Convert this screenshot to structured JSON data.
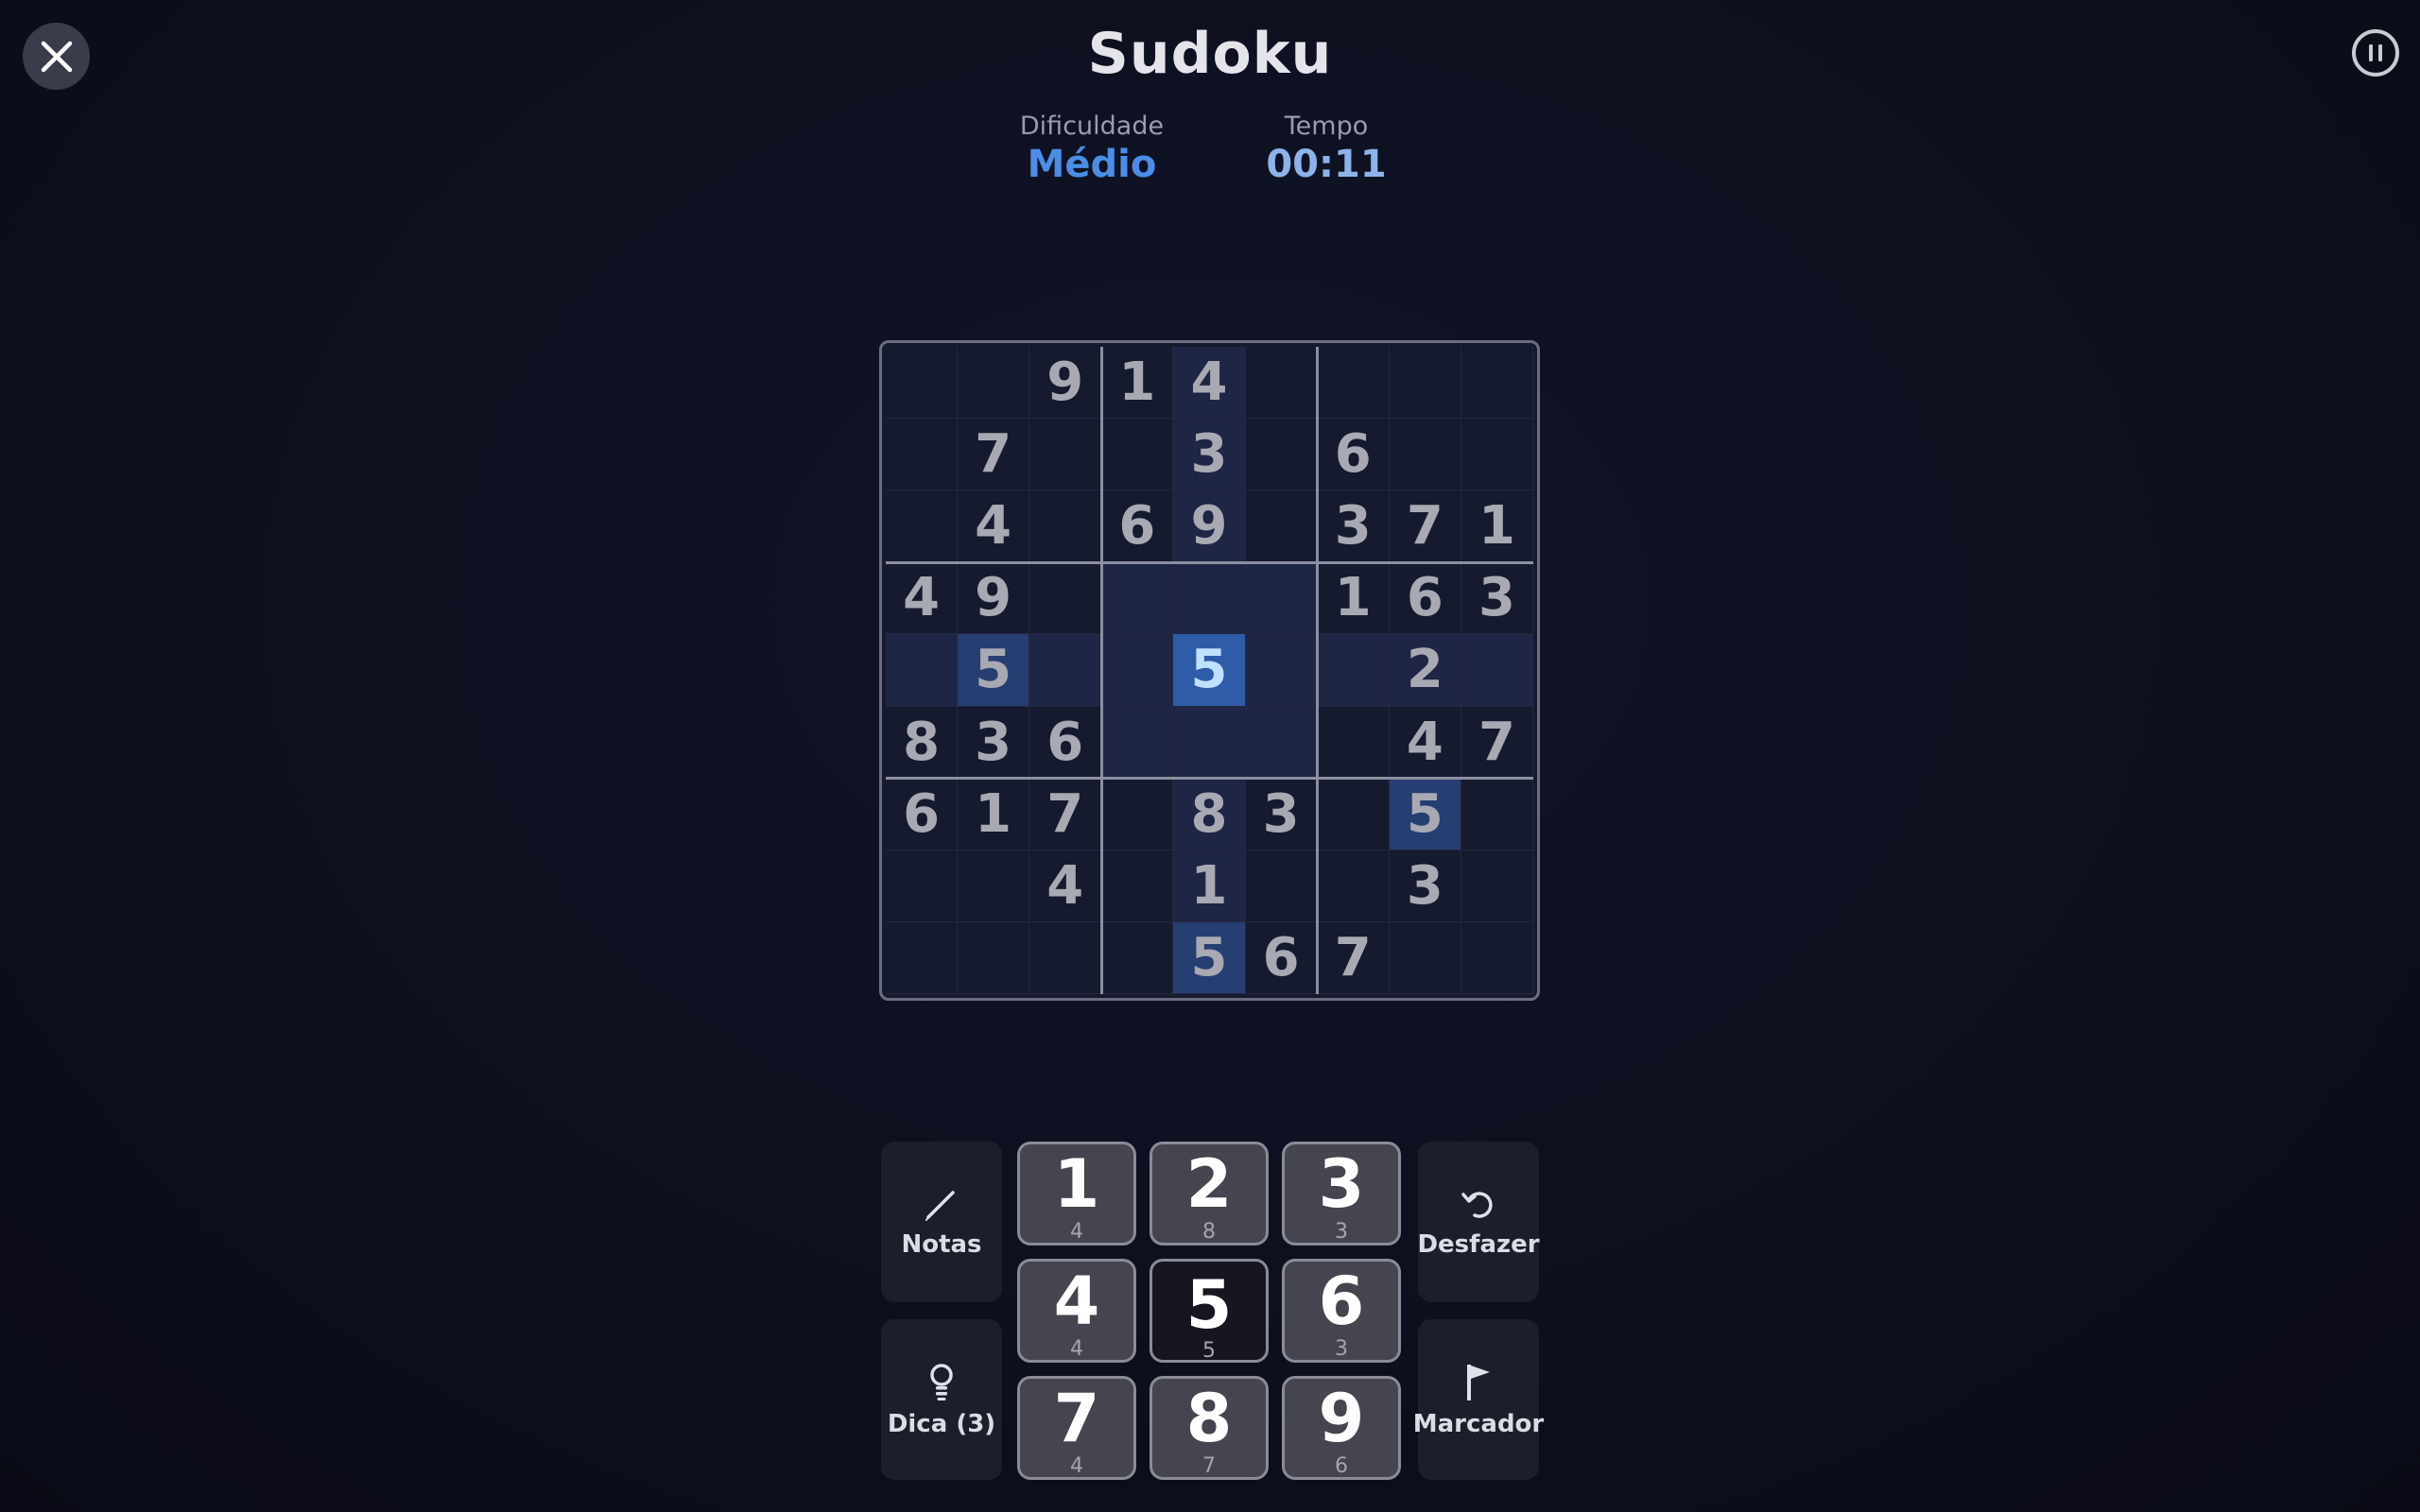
{
  "header": {
    "title": "Sudoku",
    "difficulty_label": "Dificuldade",
    "difficulty_value": "Médio",
    "time_label": "Tempo",
    "time_value": "00:11"
  },
  "board": {
    "rows": [
      [
        "",
        "",
        "9",
        "1",
        "4",
        "",
        "",
        "",
        ""
      ],
      [
        "",
        "7",
        "",
        "",
        "3",
        "",
        "6",
        "",
        ""
      ],
      [
        "",
        "4",
        "",
        "6",
        "9",
        "",
        "3",
        "7",
        "1"
      ],
      [
        "4",
        "9",
        "",
        "",
        "",
        "",
        "1",
        "6",
        "3"
      ],
      [
        "",
        "5",
        "",
        "",
        "5",
        "",
        "",
        "2",
        ""
      ],
      [
        "8",
        "3",
        "6",
        "",
        "",
        "",
        "",
        "4",
        "7"
      ],
      [
        "6",
        "1",
        "7",
        "",
        "8",
        "3",
        "",
        "5",
        ""
      ],
      [
        "",
        "",
        "4",
        "",
        "1",
        "",
        "",
        "3",
        ""
      ],
      [
        "",
        "",
        "",
        "",
        "5",
        "6",
        "7",
        "",
        ""
      ]
    ],
    "selected": [
      4,
      4
    ],
    "same_value_cells": [
      [
        4,
        1
      ],
      [
        6,
        7
      ],
      [
        8,
        4
      ]
    ]
  },
  "keypad": [
    {
      "digit": "1",
      "count": "4"
    },
    {
      "digit": "2",
      "count": "8"
    },
    {
      "digit": "3",
      "count": "3"
    },
    {
      "digit": "4",
      "count": "4"
    },
    {
      "digit": "5",
      "count": "5",
      "active": true
    },
    {
      "digit": "6",
      "count": "3"
    },
    {
      "digit": "7",
      "count": "4"
    },
    {
      "digit": "8",
      "count": "7"
    },
    {
      "digit": "9",
      "count": "6"
    }
  ],
  "actions": {
    "notes_label": "Notas",
    "hint_label": "Dica (3)",
    "undo_label": "Desfazer",
    "marker_label": "Marcador"
  },
  "icons": {
    "close": "close-icon",
    "pause": "pause-icon",
    "notes": "pencil-icon",
    "hint": "lightbulb-icon",
    "undo": "undo-icon",
    "marker": "flag-icon"
  },
  "colors": {
    "accent": "#4a8ee8",
    "selected_cell": "#2f5ca8",
    "same_value_cell": "#263e72",
    "highlight_cell": "#1e2545"
  }
}
